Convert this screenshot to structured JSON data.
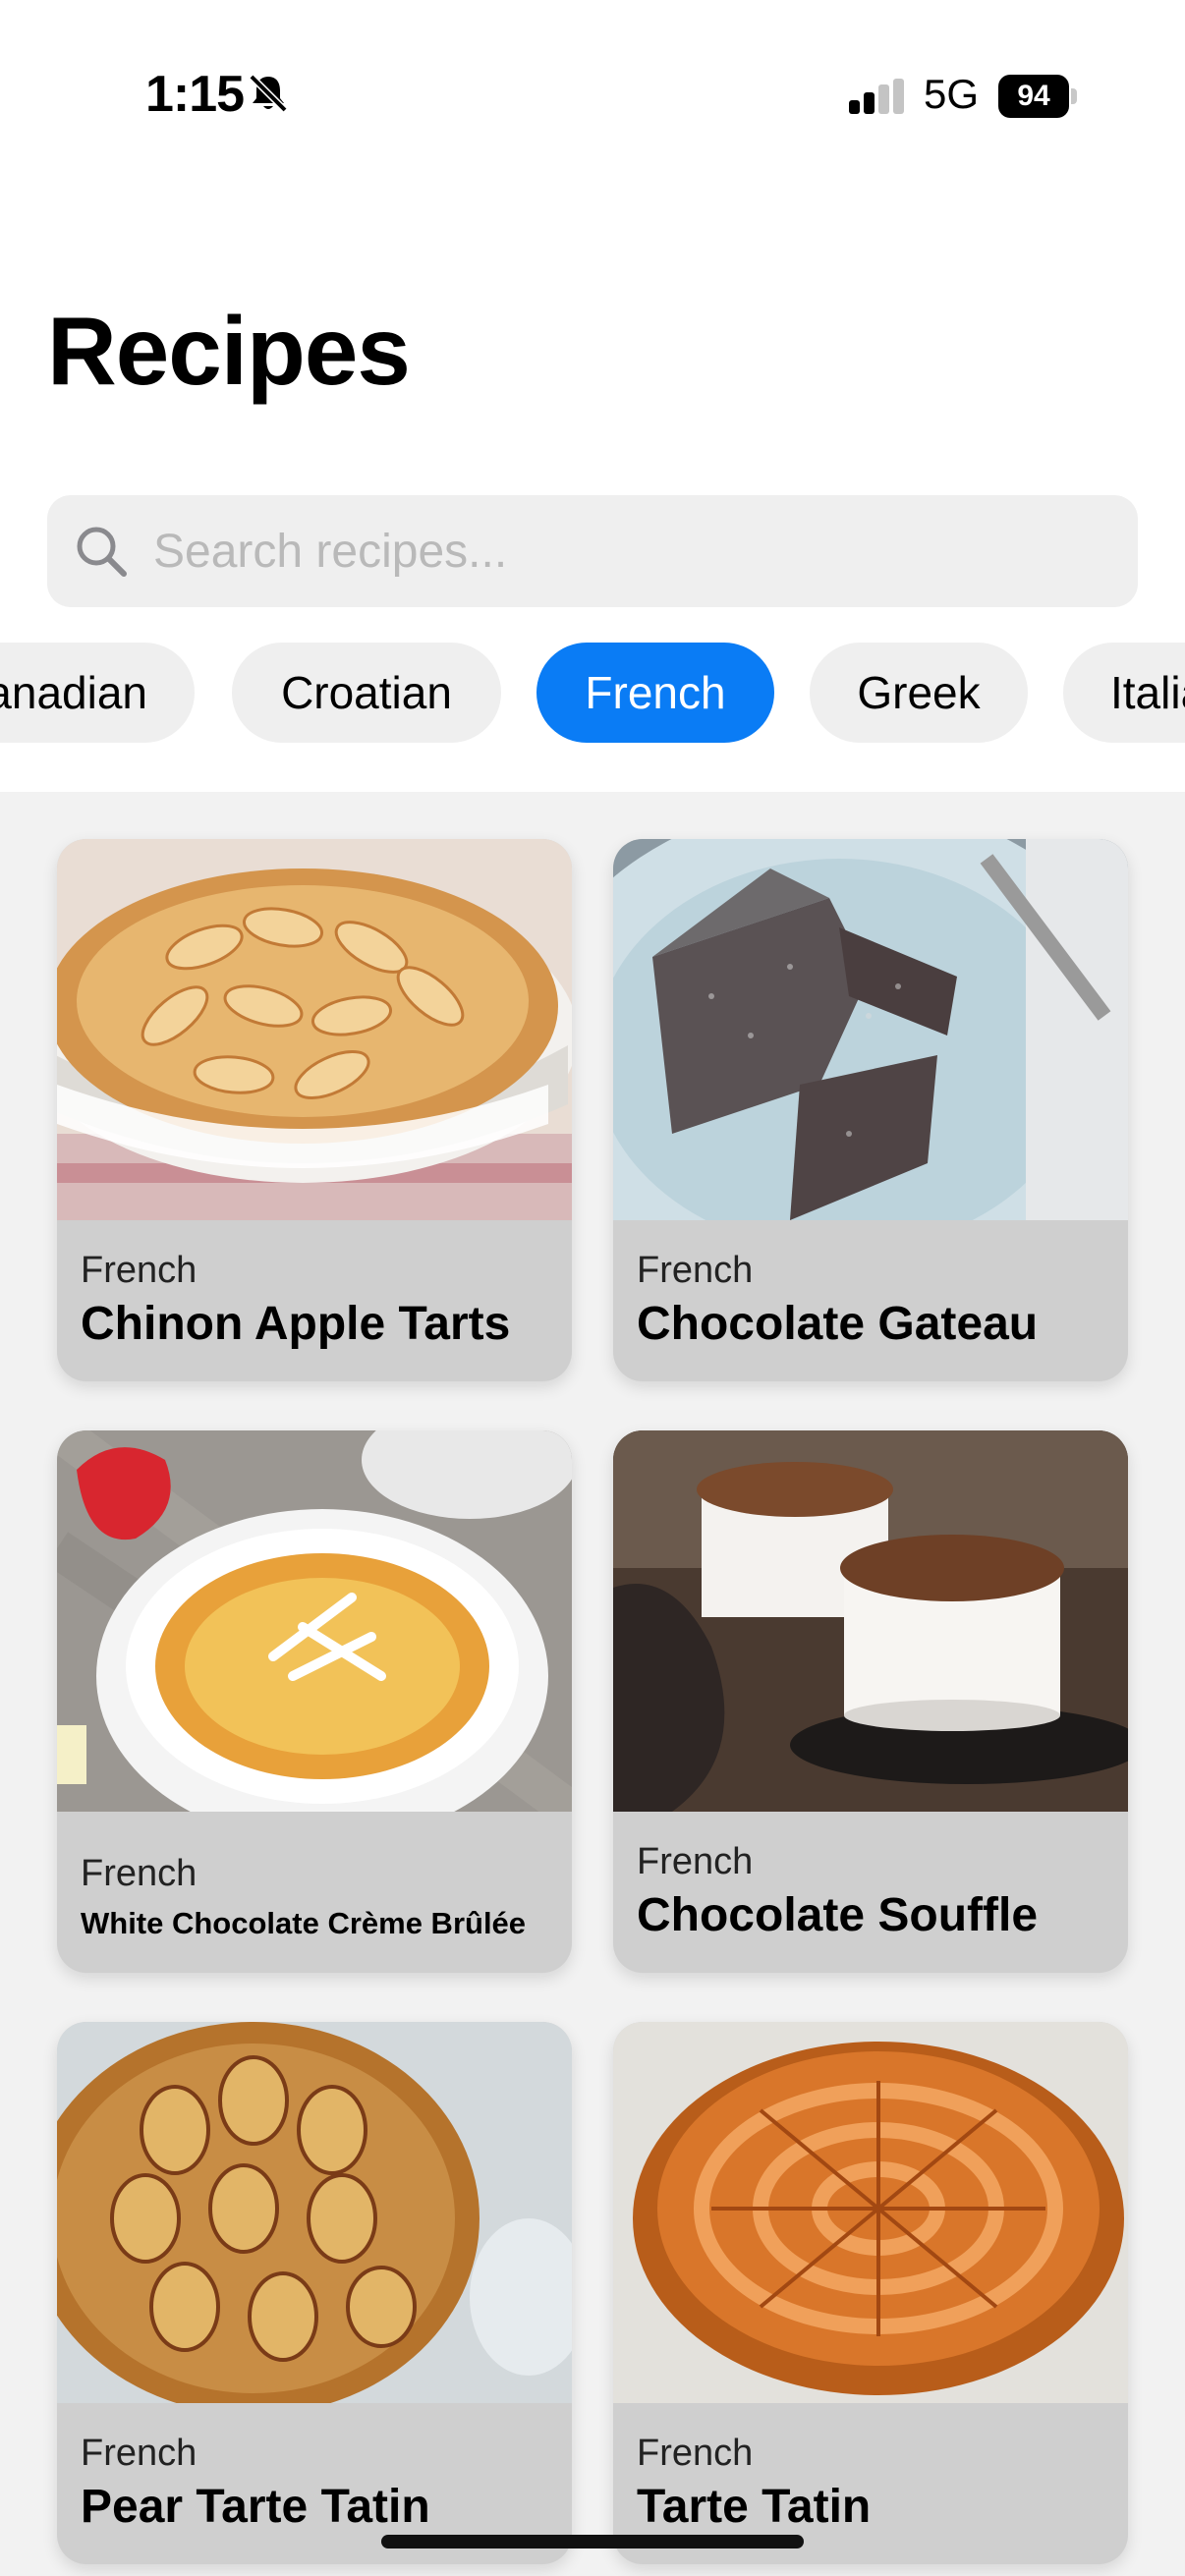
{
  "status": {
    "time": "1:15",
    "network": "5G",
    "battery": "94"
  },
  "title": "Recipes",
  "search": {
    "placeholder": "Search recipes...",
    "value": ""
  },
  "filters": [
    {
      "label": "Canadian",
      "active": false
    },
    {
      "label": "Croatian",
      "active": false
    },
    {
      "label": "French",
      "active": true
    },
    {
      "label": "Greek",
      "active": false
    },
    {
      "label": "Italian",
      "active": false
    }
  ],
  "recipes": [
    {
      "cuisine": "French",
      "name": "Chinon Apple Tarts"
    },
    {
      "cuisine": "French",
      "name": "Chocolate Gateau"
    },
    {
      "cuisine": "French",
      "name": "White Chocolate Crème Brûlée"
    },
    {
      "cuisine": "French",
      "name": "Chocolate Souffle"
    },
    {
      "cuisine": "French",
      "name": "Pear Tarte Tatin"
    },
    {
      "cuisine": "French",
      "name": "Tarte Tatin"
    }
  ],
  "colors": {
    "accent": "#0a7cf5",
    "chip_bg": "#efefef",
    "card_bg": "#cfcfcf",
    "grid_bg": "#f2f2f2"
  },
  "icons": {
    "search": "search-icon",
    "silent": "bell-slash-icon",
    "signal": "cellular-signal-icon",
    "battery": "battery-icon"
  }
}
